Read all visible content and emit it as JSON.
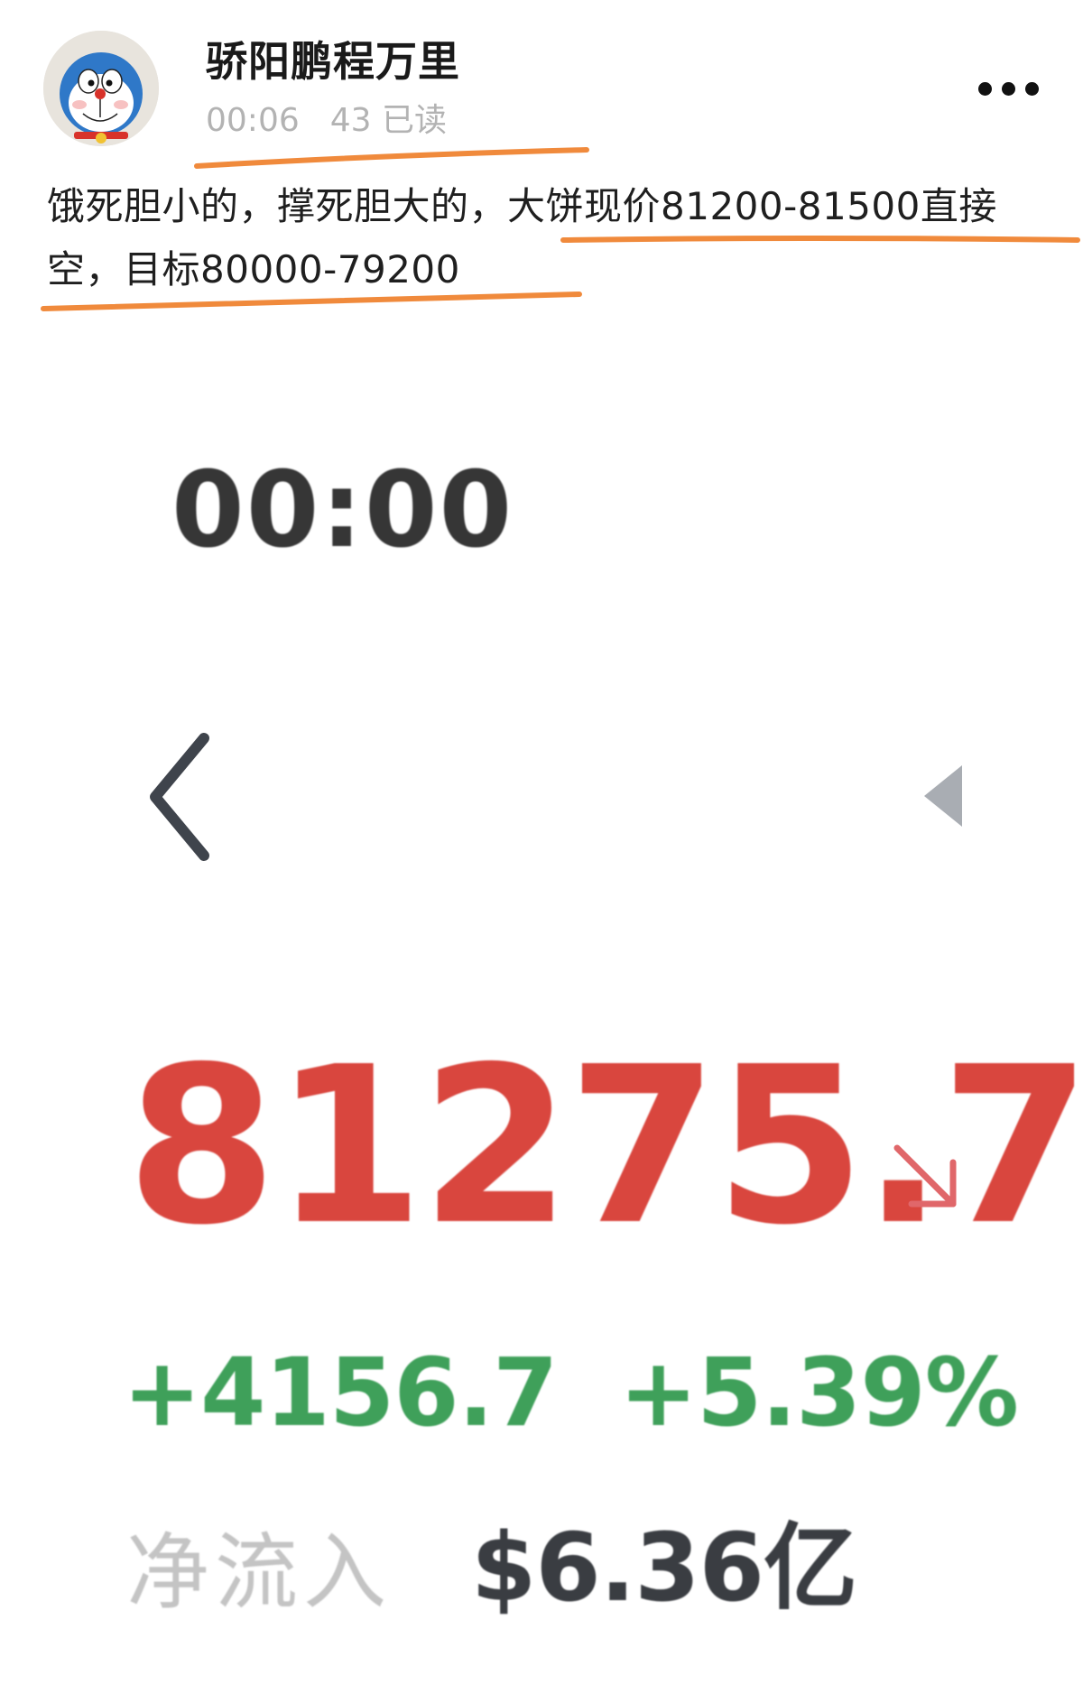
{
  "post": {
    "author_name": "骄阳鹏程万里",
    "time": "00:06",
    "read_count": "43 已读",
    "text": "饿死胆小的，撑死胆大的，大饼现价81200-81500直接空，目标80000-79200",
    "more_icon": "more-dots-icon",
    "avatar_icon": "cartoon-cat-avatar",
    "highlight_color": "#f08a3c"
  },
  "ticker": {
    "time": "00:00",
    "back_icon": "chevron-left-icon",
    "collapse_icon": "triangle-left-icon",
    "price": "81275.7",
    "trend_icon": "arrow-down-right-icon",
    "change_abs": "+4156.7",
    "change_pct": "+5.39%",
    "netflow_label": "净流入",
    "netflow_value": "$6.36亿",
    "colors": {
      "price": "#d9463e",
      "change": "#3fa05a",
      "netflow_value": "#3a3d42",
      "netflow_label": "#c4c4c4"
    }
  }
}
